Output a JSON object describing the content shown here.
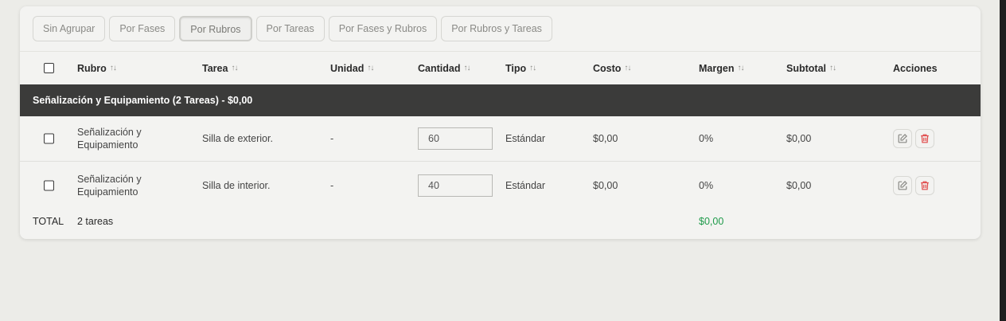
{
  "grouping": {
    "buttons": [
      {
        "label": "Sin Agrupar",
        "active": false
      },
      {
        "label": "Por Fases",
        "active": false
      },
      {
        "label": "Por Rubros",
        "active": true
      },
      {
        "label": "Por Tareas",
        "active": false
      },
      {
        "label": "Por Fases y Rubros",
        "active": false
      },
      {
        "label": "Por Rubros y Tareas",
        "active": false
      }
    ]
  },
  "table": {
    "headers": {
      "rubro": "Rubro",
      "tarea": "Tarea",
      "unidad": "Unidad",
      "cantidad": "Cantidad",
      "tipo": "Tipo",
      "costo": "Costo",
      "margen": "Margen",
      "subtotal": "Subtotal",
      "acciones": "Acciones"
    },
    "sort_glyph": "↑↓",
    "group_label": "Señalización y Equipamiento (2 Tareas) - $0,00",
    "rows": [
      {
        "rubro": "Señalización y Equipamiento",
        "tarea": "Silla de exterior.",
        "unidad": "-",
        "cantidad": "60",
        "tipo": "Estándar",
        "costo": "$0,00",
        "margen": "0%",
        "subtotal": "$0,00"
      },
      {
        "rubro": "Señalización y Equipamiento",
        "tarea": "Silla de interior.",
        "unidad": "-",
        "cantidad": "40",
        "tipo": "Estándar",
        "costo": "$0,00",
        "margen": "0%",
        "subtotal": "$0,00"
      }
    ],
    "total": {
      "label": "TOTAL",
      "count": "2 tareas",
      "amount": "$0,00"
    }
  },
  "colors": {
    "accent_green": "#1e9a4a",
    "delete_red": "#e04848",
    "group_bg": "#3b3b3a"
  },
  "icons": {
    "edit": "pencil-square-icon",
    "delete": "trash-icon"
  }
}
